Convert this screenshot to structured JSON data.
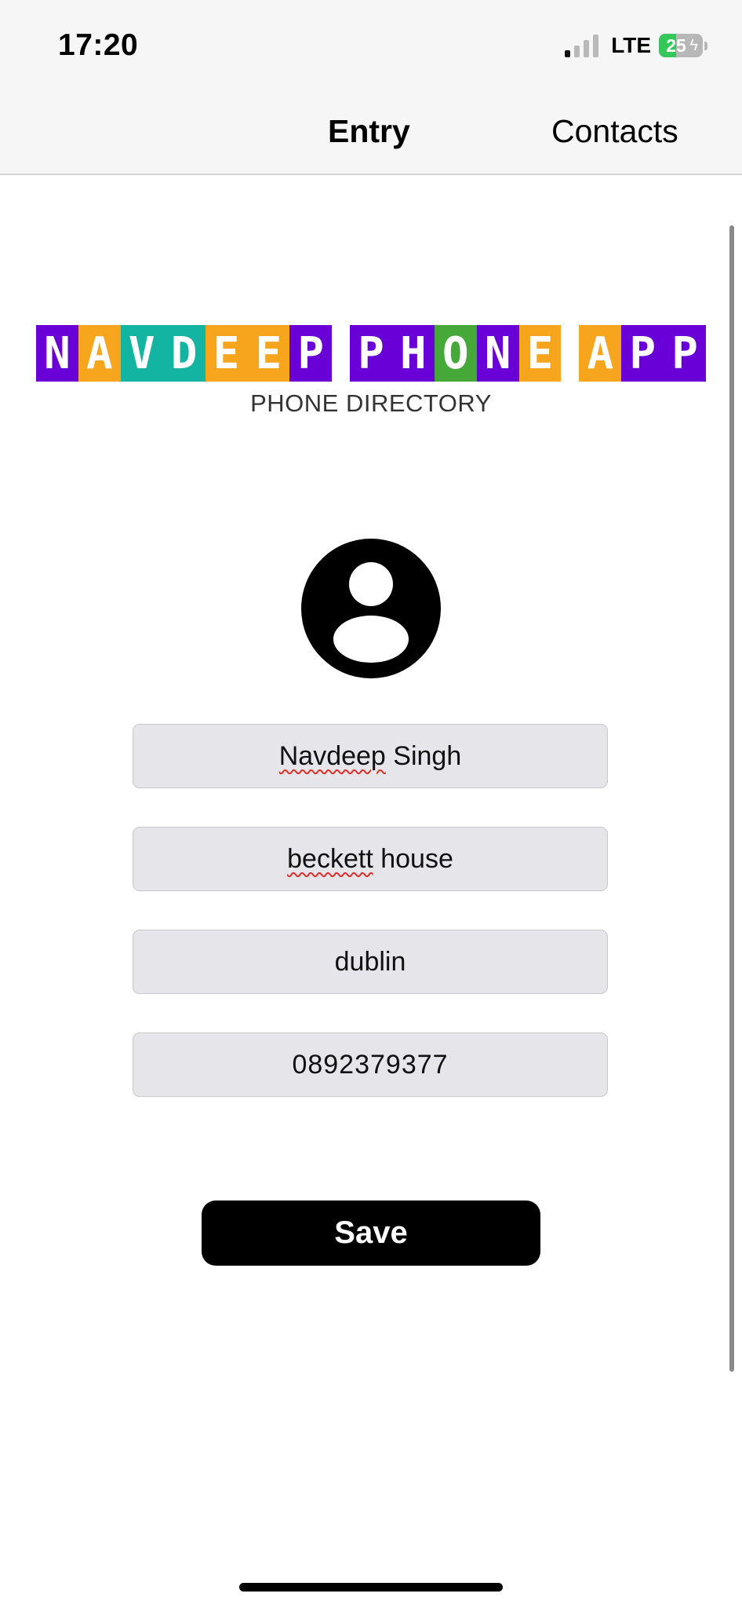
{
  "status_bar": {
    "time": "17:20",
    "network": "LTE",
    "battery_level": "25",
    "battery_charging": true,
    "signal_bars_active": 1,
    "signal_bars_total": 4
  },
  "nav": {
    "tab_entry": "Entry",
    "tab_contacts": "Contacts"
  },
  "logo": {
    "word1": "NAVDEEP",
    "word2": "PHONE",
    "word3": "APP",
    "subtitle": "PHONE DIRECTORY",
    "colors": {
      "purple": "#6a00d8",
      "orange": "#f7a51c",
      "teal": "#13b5a2",
      "green": "#47a83a"
    }
  },
  "avatar": {
    "icon": "person-circle-icon"
  },
  "form": {
    "name": {
      "value_first": "Navdeep",
      "value_rest": " Singh"
    },
    "address": {
      "value_first": "beckett",
      "value_rest": " house"
    },
    "city": {
      "value": "dublin"
    },
    "phone": {
      "value": "0892379377"
    }
  },
  "actions": {
    "save_label": "Save"
  },
  "theme": {
    "accent_button": "#000000",
    "field_background": "#e6e6ea",
    "spellcheck_underline": "#e0302a"
  }
}
